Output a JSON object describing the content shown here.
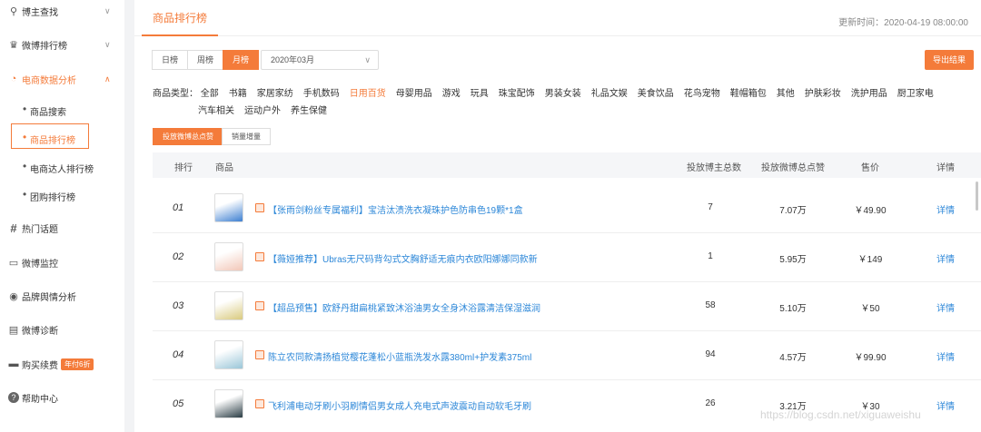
{
  "sidebar": {
    "items": [
      {
        "label": "博主查找",
        "icon": "search-icon",
        "glyph": "⚲",
        "chev": "∨"
      },
      {
        "label": "微博排行榜",
        "icon": "trophy-icon",
        "glyph": "♛",
        "chev": "∨"
      },
      {
        "label": "电商数据分析",
        "icon": "pie-chart-icon",
        "glyph": "◔",
        "chev": "∧"
      },
      {
        "label": "热门话题",
        "icon": "hashtag-icon",
        "glyph": "#"
      },
      {
        "label": "微博监控",
        "icon": "monitor-icon",
        "glyph": "▭"
      },
      {
        "label": "品牌舆情分析",
        "icon": "sentiment-icon",
        "glyph": "◉"
      },
      {
        "label": "微博诊断",
        "icon": "diagnosis-icon",
        "glyph": "▤"
      },
      {
        "label": "购买续费",
        "icon": "card-icon",
        "glyph": "▬",
        "badge": "年付6折"
      },
      {
        "label": "帮助中心",
        "icon": "help-icon",
        "glyph": "?"
      }
    ],
    "sub_items": [
      {
        "label": "商品搜索"
      },
      {
        "label": "商品排行榜"
      },
      {
        "label": "电商达人排行榜"
      },
      {
        "label": "团购排行榜"
      }
    ],
    "bullet": "•"
  },
  "header": {
    "tab": "商品排行榜",
    "updated": "更新时间：2020-04-19 08:00:00"
  },
  "filters": {
    "periods": [
      "日榜",
      "周榜",
      "月榜"
    ],
    "active_period": "月榜",
    "month": "2020年03月",
    "month_caret": "∨",
    "export": "导出结果",
    "category_label": "商品类型：",
    "categories_row1": [
      "全部",
      "书籍",
      "家居家纺",
      "手机数码",
      "日用百货",
      "母婴用品",
      "游戏",
      "玩具",
      "珠宝配饰",
      "男装女装",
      "礼品文娱",
      "美食饮品",
      "花鸟宠物",
      "鞋帽箱包",
      "其他",
      "护肤彩妆",
      "洗护用品",
      "厨卫家电"
    ],
    "categories_row2": [
      "汽车相关",
      "运动户外",
      "养生保健"
    ],
    "active_category": "日用百货",
    "metrics": [
      "投放微博总点赞",
      "销量增量"
    ],
    "active_metric": "投放微博总点赞"
  },
  "table": {
    "headers": [
      "排行",
      "商品",
      "投放博主总数",
      "投放微博总点赞",
      "售价",
      "详情"
    ],
    "rows": [
      {
        "rank": "01",
        "title": "【张雨剑粉丝专属福利】宝洁汰渍洗衣凝珠护色防串色19颗*1盒",
        "bloggers": "7",
        "likes": "7.07万",
        "price": "￥49.90",
        "detail": "详情",
        "thumb": "#3d7fd1"
      },
      {
        "rank": "02",
        "title": "【薇娅推荐】Ubras无尺码背勾式文胸舒适无痕内衣欧阳娜娜同款新",
        "bloggers": "1",
        "likes": "5.95万",
        "price": "￥149",
        "detail": "详情",
        "thumb": "#f2c7b8"
      },
      {
        "rank": "03",
        "title": "【超品预售】欧舒丹甜扁桃紧致沐浴油男女全身沐浴露清洁保湿滋润",
        "bloggers": "58",
        "likes": "5.10万",
        "price": "￥50",
        "detail": "详情",
        "thumb": "#d9ca7e"
      },
      {
        "rank": "04",
        "title": "陈立农同款清扬植觉樱花蓬松小蓝瓶洗发水露380ml+护发素375ml",
        "bloggers": "94",
        "likes": "4.57万",
        "price": "￥99.90",
        "detail": "详情",
        "thumb": "#9ac6d8"
      },
      {
        "rank": "05",
        "title": "飞利浦电动牙刷小羽刷情侣男女成人充电式声波震动自动软毛牙刷",
        "bloggers": "26",
        "likes": "3.21万",
        "price": "￥30",
        "detail": "详情",
        "thumb": "#2a3c44"
      }
    ]
  },
  "watermark": "https://blog.csdn.net/xiguaweishu",
  "colors": {
    "accent": "#f47b3a",
    "link": "#2c87d8"
  }
}
